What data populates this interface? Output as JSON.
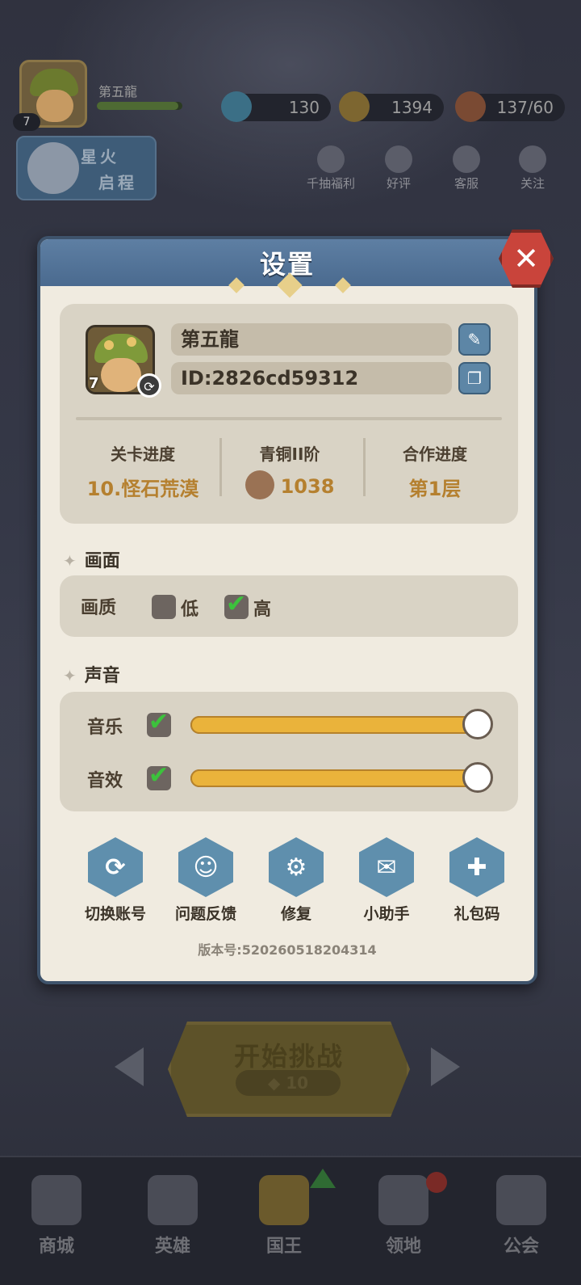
{
  "top_hud": {
    "player_name": "第五龍",
    "level": "7",
    "experience_fraction": 0.95,
    "diamonds": "130",
    "coins": "1394",
    "stamina": "137/60",
    "event_banner": [
      "星火",
      "启程"
    ],
    "quick_links": [
      "千抽福利",
      "好评",
      "客服",
      "关注"
    ]
  },
  "dialog": {
    "title": "设置",
    "close_icon": "close-icon",
    "profile": {
      "name": "第五龍",
      "id": "ID:2826cd59312",
      "level": "7",
      "edit_icon": "pencil-icon",
      "copy_icon": "copy-icon",
      "stats": [
        {
          "label": "关卡进度",
          "value": "10.怪石荒漠"
        },
        {
          "label": "青铜II阶",
          "value": "1038"
        },
        {
          "label": "合作进度",
          "value": "第1层"
        }
      ]
    },
    "graphics": {
      "section_title": "画面",
      "quality_label": "画质",
      "options": [
        {
          "label": "低",
          "checked": false
        },
        {
          "label": "高",
          "checked": true
        }
      ]
    },
    "sound": {
      "section_title": "声音",
      "music": {
        "label": "音乐",
        "enabled": true,
        "volume": 1.0
      },
      "effects": {
        "label": "音效",
        "enabled": true,
        "volume": 1.0
      }
    },
    "actions": [
      {
        "label": "切换账号",
        "icon": "swap-account-icon"
      },
      {
        "label": "问题反馈",
        "icon": "feedback-icon"
      },
      {
        "label": "修复",
        "icon": "wrench-gear-icon"
      },
      {
        "label": "小助手",
        "icon": "wechat-icon"
      },
      {
        "label": "礼包码",
        "icon": "gift-icon"
      }
    ],
    "version": "版本号:520260518204314"
  },
  "stage": {
    "start_label": "开始挑战",
    "cost": "10"
  },
  "bottom_nav": [
    {
      "label": "商城"
    },
    {
      "label": "英雄"
    },
    {
      "label": "国王"
    },
    {
      "label": "领地"
    },
    {
      "label": "公会"
    }
  ],
  "colors": {
    "dialog_header": "#4a6a8f",
    "dialog_body": "#f0ebe0",
    "accent_gold": "#b5802f",
    "slider_fill": "#eab33b",
    "close_red": "#c9443b",
    "check_green": "#3cc23c"
  }
}
